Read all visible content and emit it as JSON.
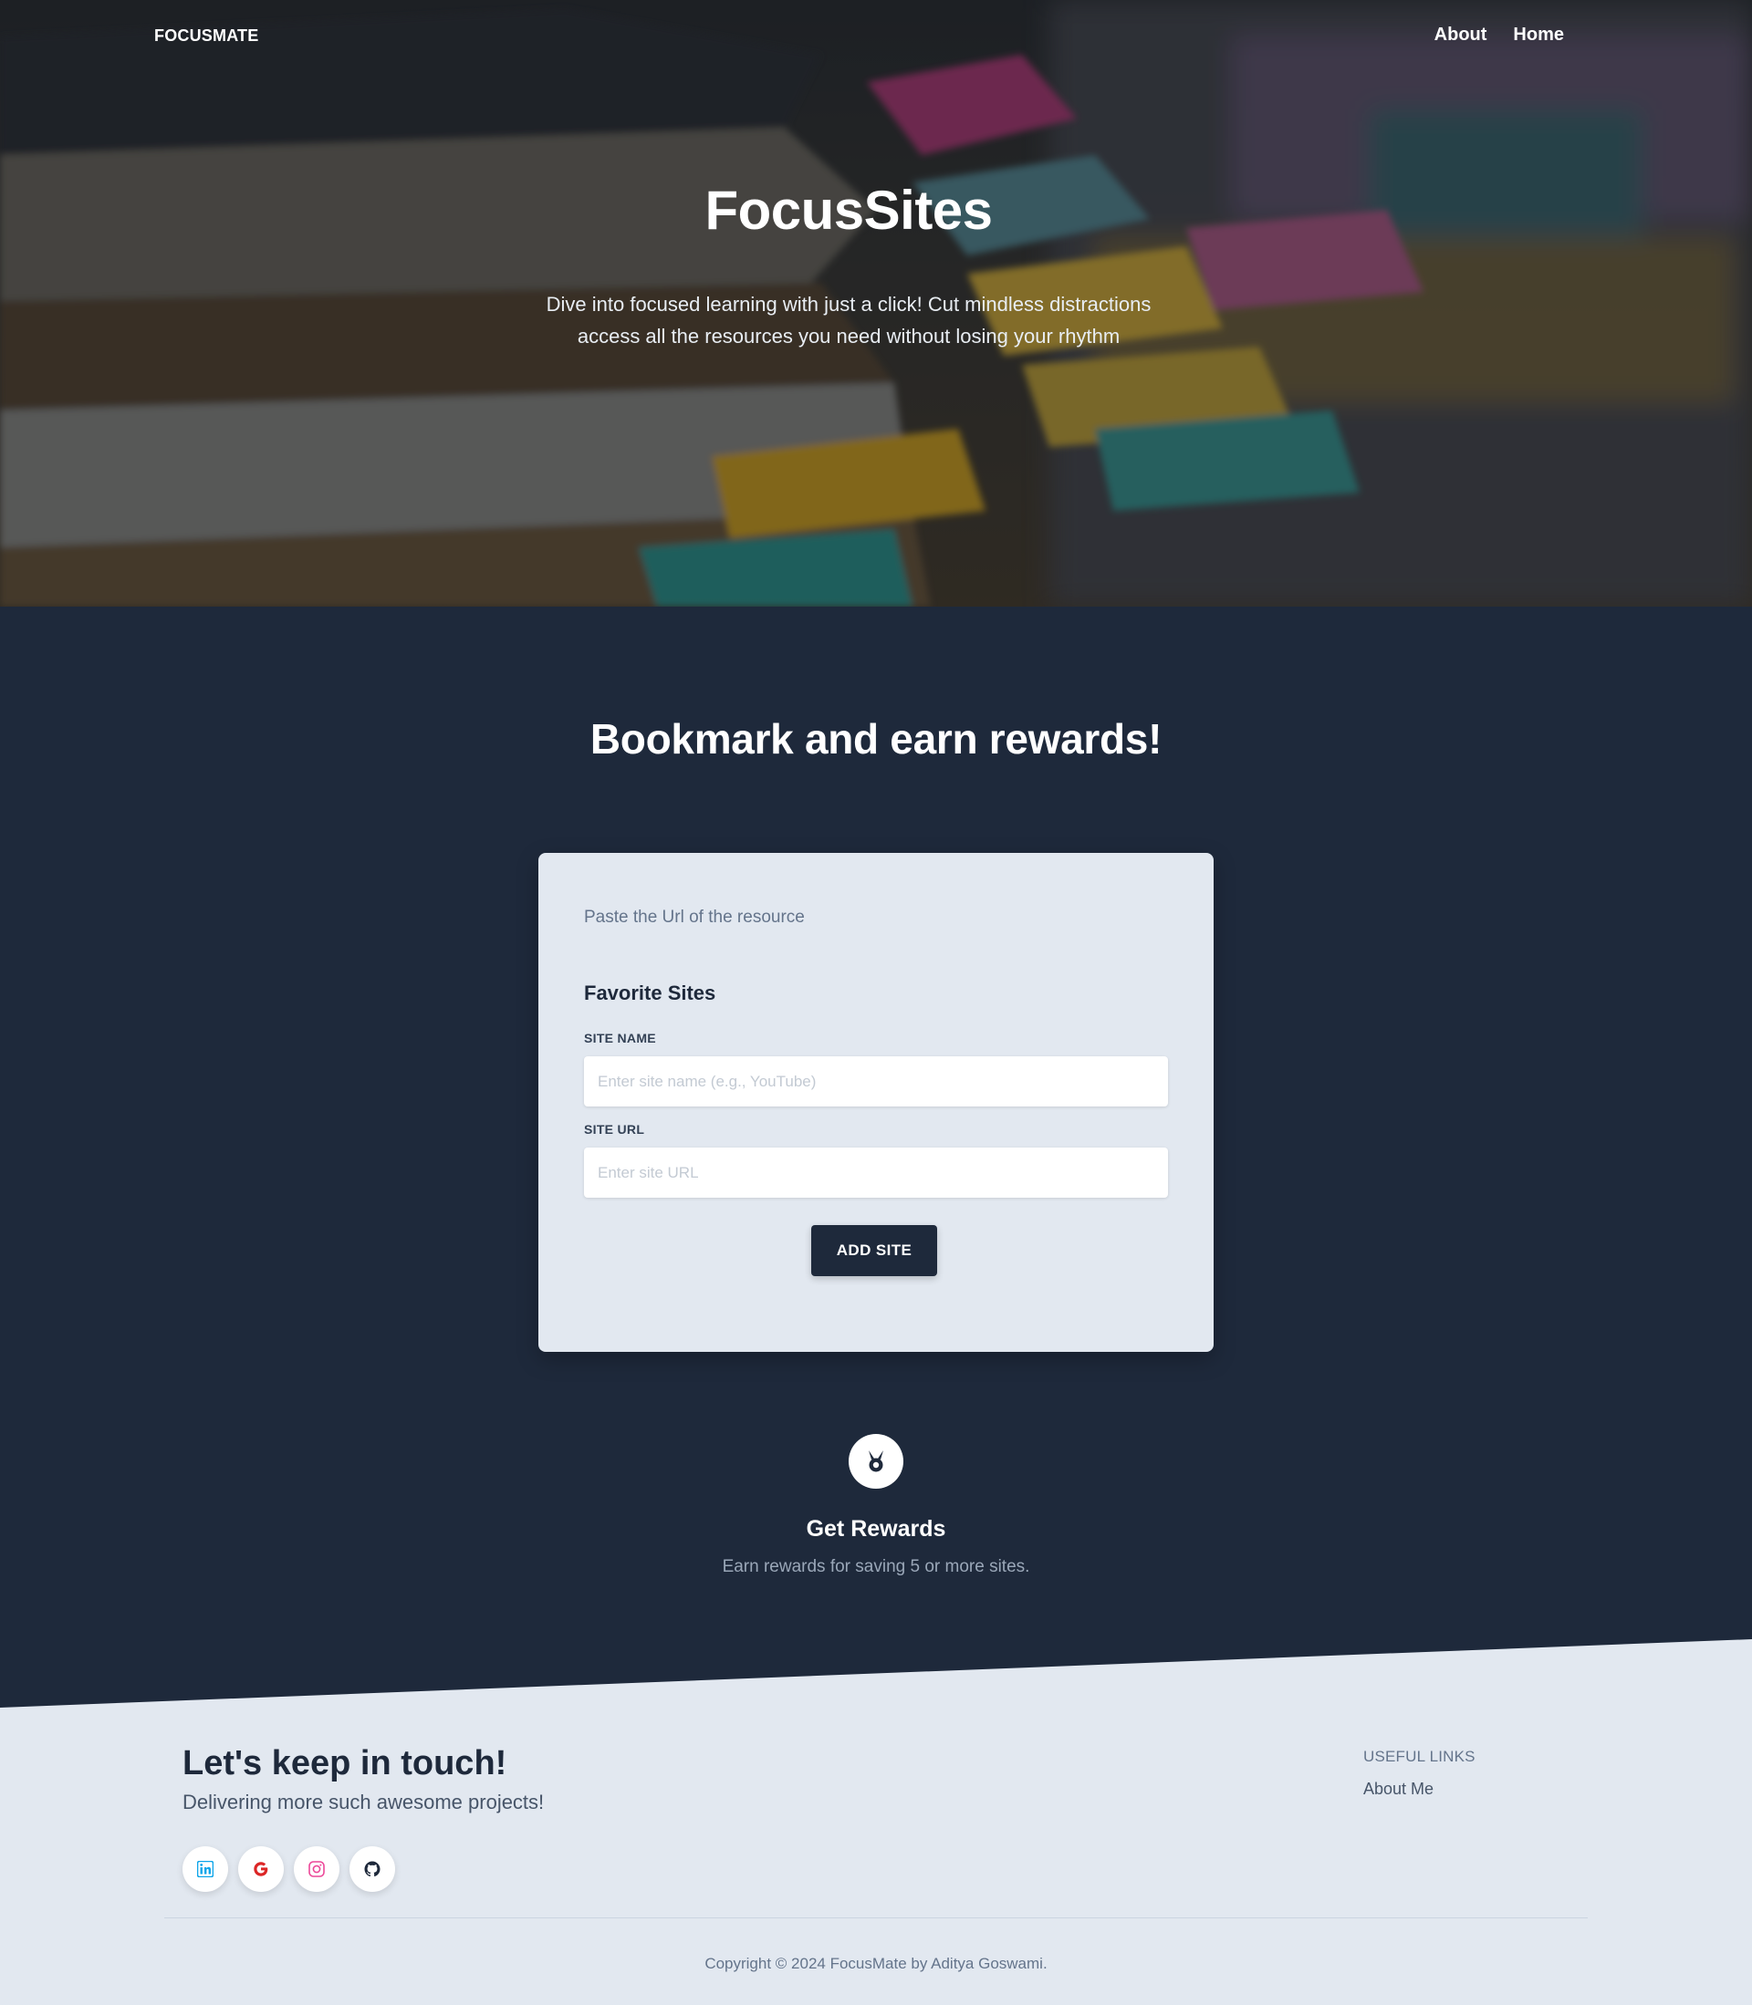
{
  "nav": {
    "brand": "FOCUSMATE",
    "links": [
      "About",
      "Home"
    ]
  },
  "hero": {
    "title": "FocusSites",
    "subtitle": "Dive into focused learning with just a click! Cut mindless distractions access all the resources you need without losing your rhythm"
  },
  "bookmark": {
    "heading": "Bookmark and earn rewards!",
    "hint": "Paste the Url of the resource",
    "form_title": "Favorite Sites",
    "site_name_label": "SITE NAME",
    "site_name_placeholder": "Enter site name (e.g., YouTube)",
    "site_name_value": "",
    "site_url_label": "SITE URL",
    "site_url_placeholder": "Enter site URL",
    "site_url_value": "",
    "add_button": "ADD SITE"
  },
  "rewards": {
    "icon": "medal-icon",
    "title": "Get Rewards",
    "description": "Earn rewards for saving 5 or more sites."
  },
  "footer": {
    "title": "Let's keep in touch!",
    "subtitle": "Delivering more such awesome projects!",
    "socials": [
      {
        "icon": "linkedin-icon",
        "color": "#0ea5e9"
      },
      {
        "icon": "google-icon",
        "color": "#dc2626"
      },
      {
        "icon": "instagram-icon",
        "color": "#ec4899"
      },
      {
        "icon": "github-icon",
        "color": "#1e293b"
      }
    ],
    "links_title": "USEFUL LINKS",
    "links": [
      "About Me"
    ],
    "copyright": "Copyright © 2024 FocusMate by Aditya Goswami."
  },
  "colors": {
    "dark_bg": "#1e293b",
    "light_bg": "#e2e8f0",
    "button": "#1e293b",
    "text_muted": "#64748b"
  }
}
